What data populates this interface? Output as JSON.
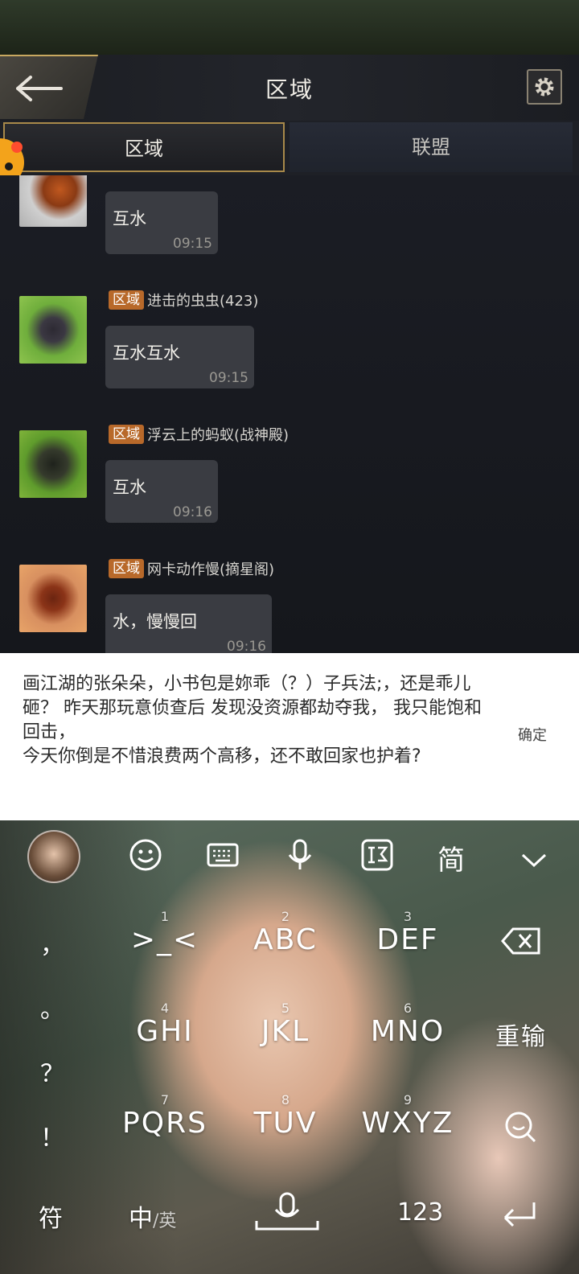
{
  "header": {
    "title": "区域"
  },
  "tabs": [
    {
      "label": "区域"
    },
    {
      "label": "联盟"
    }
  ],
  "messages": [
    {
      "tag": "",
      "name": "",
      "text": "互水",
      "time": "09:15"
    },
    {
      "tag": "区域",
      "name": "进击的虫虫(423)",
      "text": "互水互水",
      "time": "09:15"
    },
    {
      "tag": "区域",
      "name": "浮云上的蚂蚁(战神殿)",
      "text": "互水",
      "time": "09:16"
    },
    {
      "tag": "区域",
      "name": "网卡动作慢(摘星阁)",
      "text": "水，慢慢回",
      "time": "09:16"
    }
  ],
  "compose": {
    "text": "画江湖的张朵朵，小书包是妳乖（？）子兵法;，还是乖儿砸？ 昨天那玩意侦查后 发现没资源都劫夺我， 我只能饱和回击，\n今天你倒是不惜浪费两个高移，还不敢回家也护着?",
    "confirm_label": "确定"
  },
  "keyboard": {
    "toolbar": {
      "simplified_label": "简"
    },
    "keys": [
      {
        "num": "1",
        "label": ">_<"
      },
      {
        "num": "2",
        "label": "ABC"
      },
      {
        "num": "3",
        "label": "DEF"
      },
      {
        "num": "4",
        "label": "GHI"
      },
      {
        "num": "5",
        "label": "JKL"
      },
      {
        "num": "6",
        "label": "MNO"
      },
      {
        "num": "7",
        "label": "PQRS"
      },
      {
        "num": "8",
        "label": "TUV"
      },
      {
        "num": "9",
        "label": "WXYZ"
      }
    ],
    "symbols": [
      "，",
      "。",
      "？",
      "！"
    ],
    "reenter_label": "重输",
    "bottom": {
      "symbols_label": "符",
      "zh_label": "中",
      "en_label": "/英",
      "numbers_label": "123"
    }
  }
}
